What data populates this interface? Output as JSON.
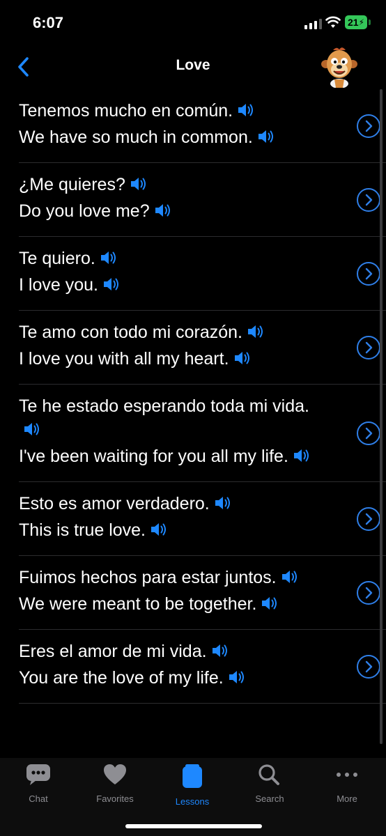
{
  "status_bar": {
    "time": "6:07",
    "battery": "21"
  },
  "nav": {
    "title": "Love"
  },
  "phrases": [
    {
      "spanish": "Tenemos mucho en común.",
      "english": "We have so much in common."
    },
    {
      "spanish": "¿Me quieres?",
      "english": "Do you love me?"
    },
    {
      "spanish": "Te quiero.",
      "english": "I love you."
    },
    {
      "spanish": "Te amo con todo mi corazón.",
      "english": "I love you with all my heart."
    },
    {
      "spanish": "Te he estado esperando toda mi vida.",
      "english": "I've been waiting for you all my life."
    },
    {
      "spanish": "Esto es amor verdadero.",
      "english": "This is true love."
    },
    {
      "spanish": "Fuimos hechos para estar juntos.",
      "english": "We were meant to be together."
    },
    {
      "spanish": "Eres el amor de mi vida.",
      "english": "You are the love of my life."
    }
  ],
  "tabs": [
    {
      "label": "Chat",
      "icon": "chat-bubble-icon",
      "active": false
    },
    {
      "label": "Favorites",
      "icon": "heart-icon",
      "active": false
    },
    {
      "label": "Lessons",
      "icon": "lessons-icon",
      "active": true
    },
    {
      "label": "Search",
      "icon": "search-icon",
      "active": false
    },
    {
      "label": "More",
      "icon": "more-icon",
      "active": false
    }
  ],
  "colors": {
    "accent": "#1e88ff",
    "background": "#000000",
    "inactive": "#8e8e93",
    "battery": "#34c759"
  }
}
